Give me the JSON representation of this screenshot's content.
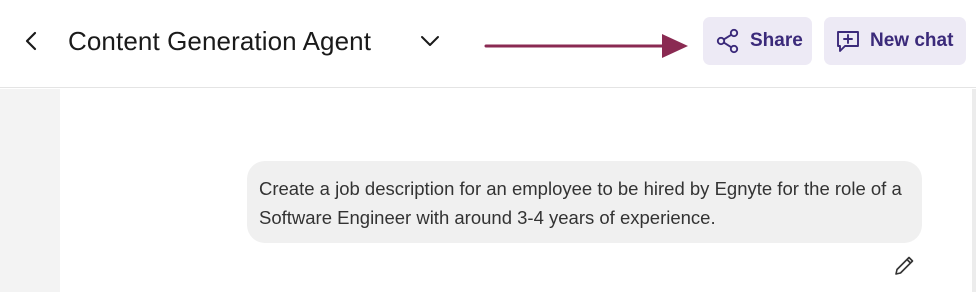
{
  "header": {
    "title": "Content Generation Agent",
    "icons": {
      "back": "chevron-left-icon",
      "dropdown": "chevron-down-icon",
      "share": "share-icon",
      "new_chat": "chat-plus-icon"
    },
    "share_label": "Share",
    "new_chat_label": "New chat"
  },
  "annotation": {
    "type": "arrow",
    "points_to": "share-button"
  },
  "conversation": {
    "messages": [
      {
        "role": "user",
        "text": "Create a job description for an employee to be hired by Egnyte for the role of a Software Engineer with around 3-4 years of experience.",
        "action_icon": "pencil-icon"
      }
    ]
  },
  "colors": {
    "accent": "#3b2a7a",
    "button_bg": "#edeaf5",
    "annotation_arrow": "#8a2a52",
    "bubble_bg": "#f0f0f0",
    "rail_bg": "#f3f3f3",
    "title_text": "#1a1a1a",
    "message_text": "#333333"
  }
}
